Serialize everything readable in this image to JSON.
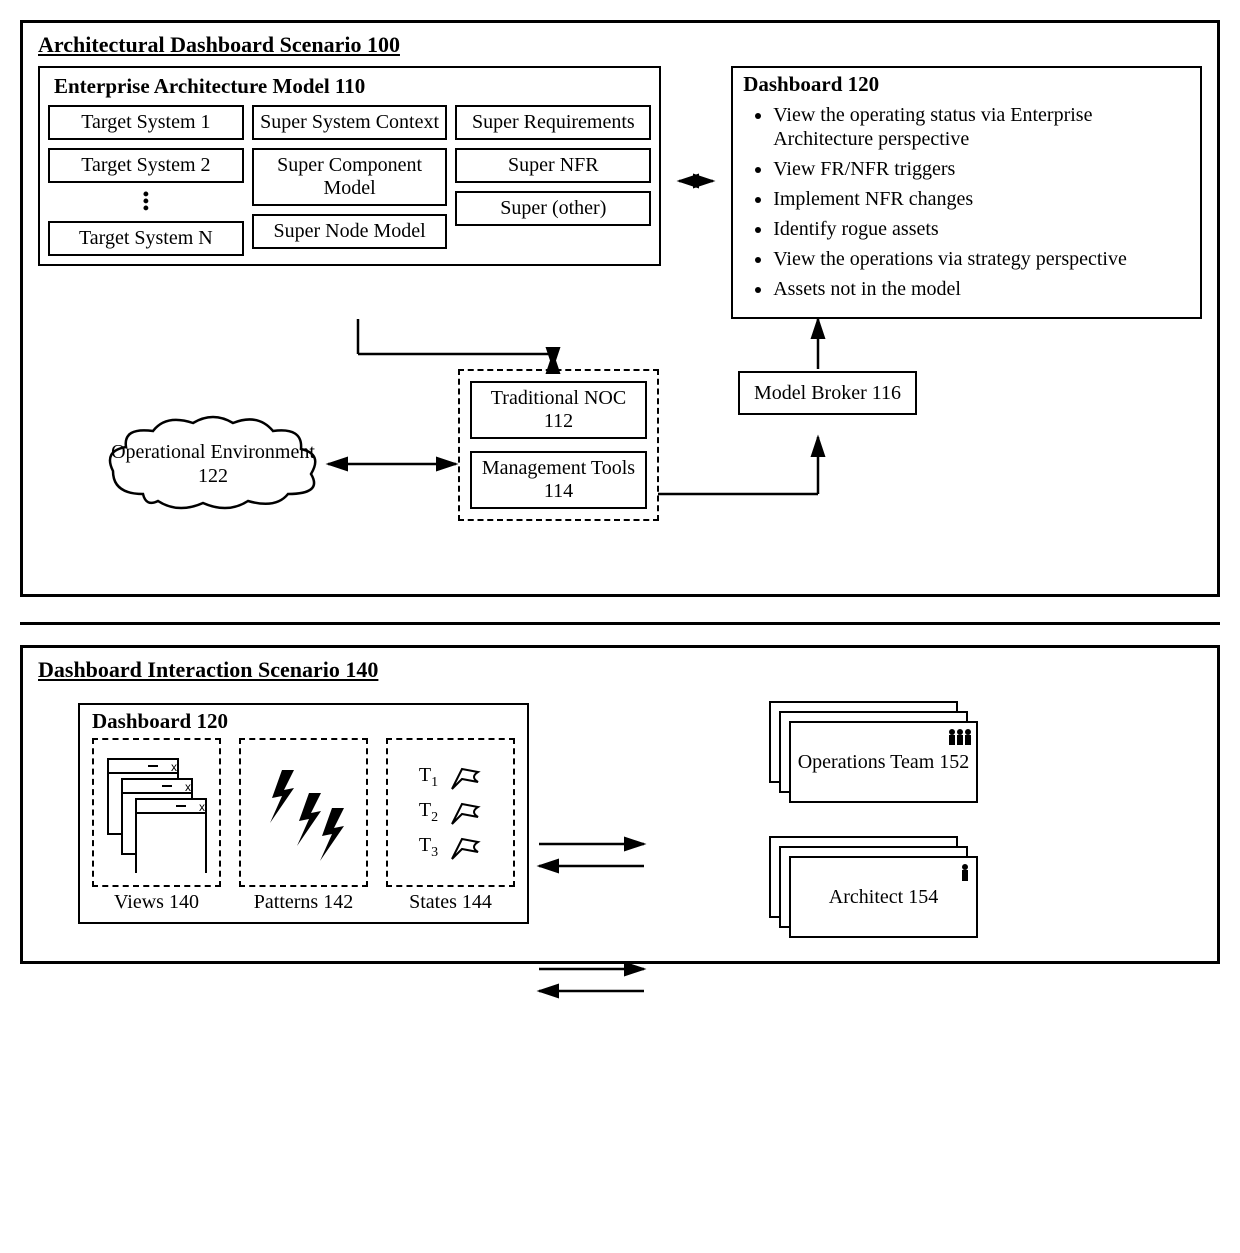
{
  "scenario100": {
    "title": "Architectural Dashboard Scenario 100",
    "ea": {
      "title": "Enterprise Architecture Model 110",
      "col1": [
        "Target System 1",
        "Target System 2",
        "Target System N"
      ],
      "col2": [
        "Super System Context",
        "Super Component Model",
        "Super Node Model"
      ],
      "col3": [
        "Super Requirements",
        "Super NFR",
        "Super (other)"
      ]
    },
    "dashboard": {
      "title": "Dashboard 120",
      "bullets": [
        "View the operating status via Enterprise Architecture perspective",
        "View FR/NFR triggers",
        "Implement NFR changes",
        "Identify rogue assets",
        "View the operations via strategy perspective",
        "Assets not in the model"
      ]
    },
    "cloud": "Operational Environment 122",
    "noc": "Traditional NOC 112",
    "tools": "Management Tools 114",
    "broker": "Model Broker 116"
  },
  "scenario140": {
    "title": "Dashboard Interaction Scenario 140",
    "dashboard_title": "Dashboard 120",
    "views": "Views 140",
    "patterns": "Patterns 142",
    "states": "States 144",
    "state_labels": [
      "T",
      "T",
      "T"
    ],
    "state_subs": [
      "1",
      "2",
      "3"
    ],
    "ops_team": "Operations Team 152",
    "architect": "Architect 154"
  }
}
